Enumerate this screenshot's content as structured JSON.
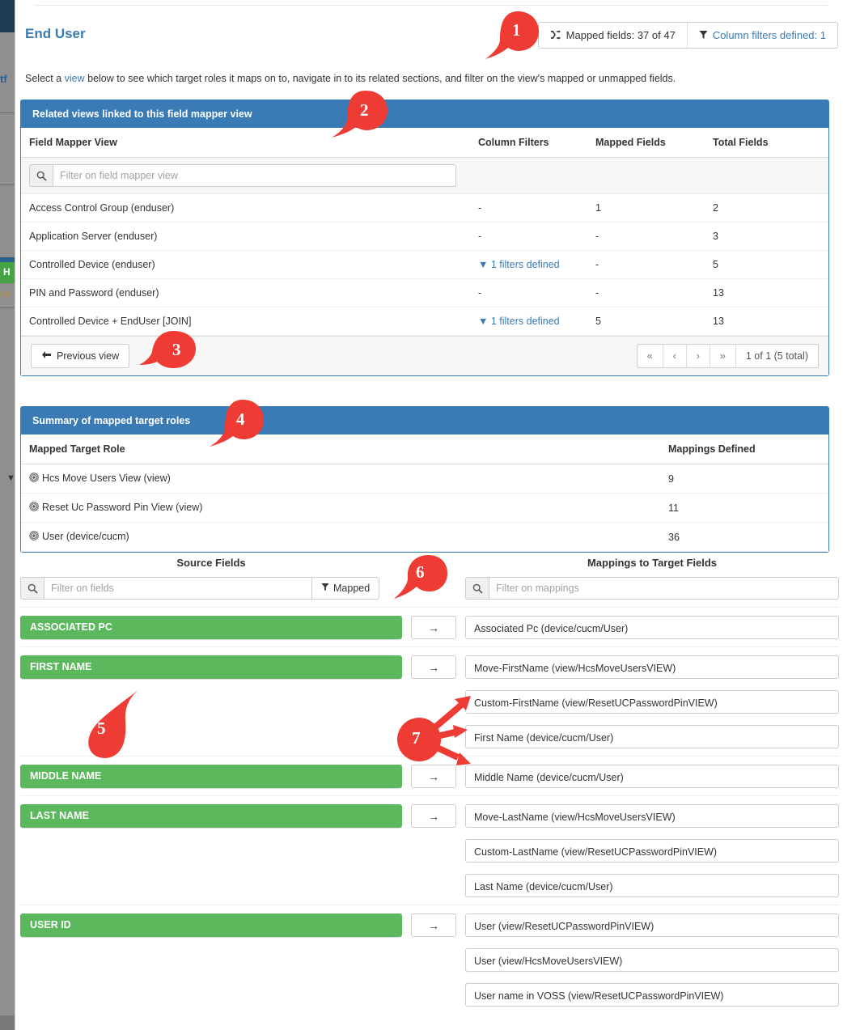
{
  "header": {
    "title": "End User",
    "buttons": [
      {
        "icon": "shuffle-icon",
        "label": "Mapped fields: 37 of 47",
        "style": "dark"
      },
      {
        "icon": "funnel-icon",
        "label": "Column filters defined: 1",
        "style": "link"
      }
    ]
  },
  "intro": {
    "before": "Select a ",
    "link": "view",
    "after": " below to see which target roles it maps on to, navigate in to its related sections, and filter on the view's mapped or unmapped fields."
  },
  "related_views_panel": {
    "title": "Related views linked to this field mapper view",
    "columns": [
      "Field Mapper View",
      "Column Filters",
      "Mapped Fields",
      "Total Fields"
    ],
    "filter_placeholder": "Filter on field mapper view",
    "filter_value": "",
    "rows": [
      {
        "view": "Access Control Group (enduser)",
        "column_filters": "-",
        "column_filters_link": false,
        "mapped_fields": "1",
        "total_fields": "2"
      },
      {
        "view": "Application Server (enduser)",
        "column_filters": "-",
        "column_filters_link": false,
        "mapped_fields": "-",
        "total_fields": "3"
      },
      {
        "view": "Controlled Device (enduser)",
        "column_filters": "1 filters defined",
        "column_filters_link": true,
        "mapped_fields": "-",
        "total_fields": "5"
      },
      {
        "view": "PIN and Password (enduser)",
        "column_filters": "-",
        "column_filters_link": false,
        "mapped_fields": "-",
        "total_fields": "13"
      },
      {
        "view": "Controlled Device + EndUser [JOIN]",
        "column_filters": "1 filters defined",
        "column_filters_link": true,
        "mapped_fields": "5",
        "total_fields": "13"
      }
    ],
    "footer": {
      "previous_view_label": "Previous view",
      "previous_view_icon": "arrow-left-icon",
      "pager": {
        "first": "«",
        "prev": "‹",
        "next": "›",
        "last": "»",
        "total": "1 of 1 (5 total)"
      }
    }
  },
  "summary_panel": {
    "title": "Summary of mapped target roles",
    "columns": [
      "Mapped Target Role",
      "Mappings Defined"
    ],
    "rows": [
      {
        "icon": "bullseye-icon",
        "role": "Hcs Move Users View (view)",
        "mappings": "9"
      },
      {
        "icon": "bullseye-icon",
        "role": "Reset Uc Password Pin View (view)",
        "mappings": "11"
      },
      {
        "icon": "bullseye-icon",
        "role": "User (device/cucm)",
        "mappings": "36"
      }
    ]
  },
  "mapper": {
    "source_title": "Source Fields",
    "target_title": "Mappings to Target Fields",
    "source_filter_placeholder": "Filter on fields",
    "source_filter_value": "",
    "mapped_filter_label": "Mapped",
    "mapped_filter_icon": "funnel-icon",
    "target_filter_placeholder": "Filter on mappings",
    "target_filter_value": "",
    "arrow_icon": "arrow-right-icon",
    "groups": [
      {
        "source": "ASSOCIATED PC",
        "targets": [
          "Associated Pc (device/cucm/User)"
        ]
      },
      {
        "source": "FIRST NAME",
        "targets": [
          "Move-FirstName (view/HcsMoveUsersVIEW)",
          "Custom-FirstName (view/ResetUCPasswordPinVIEW)",
          "First Name (device/cucm/User)"
        ]
      },
      {
        "source": "MIDDLE NAME",
        "targets": [
          "Middle Name (device/cucm/User)"
        ]
      },
      {
        "source": "LAST NAME",
        "targets": [
          "Move-LastName (view/HcsMoveUsersVIEW)",
          "Custom-LastName (view/ResetUCPasswordPinVIEW)",
          "Last Name (device/cucm/User)"
        ]
      },
      {
        "source": "USER ID",
        "targets": [
          "User (view/ResetUCPasswordPinVIEW)",
          "User (view/HcsMoveUsersVIEW)",
          "User name in VOSS (view/ResetUCPasswordPinVIEW)"
        ]
      }
    ]
  },
  "annotations": [
    {
      "number": "1",
      "target": "mapped-fields-button"
    },
    {
      "number": "2",
      "target": "related-views-panel-header"
    },
    {
      "number": "3",
      "target": "previous-view-button"
    },
    {
      "number": "4",
      "target": "summary-panel-header"
    },
    {
      "number": "5",
      "target": "source-field-first-name"
    },
    {
      "number": "6",
      "target": "mapped-filter-button"
    },
    {
      "number": "7",
      "target": "target-fields-first-name"
    }
  ],
  "colors": {
    "accent_blue": "#3a7ab5",
    "mapped_green": "#5cb85c",
    "callout_red": "#ee3b33",
    "link_blue": "#3a7ab5"
  },
  "background_hints": {
    "navbar": "#1f3a53",
    "fragment_1": "tf",
    "fragment_2": "H",
    "fragment_3": "de"
  }
}
